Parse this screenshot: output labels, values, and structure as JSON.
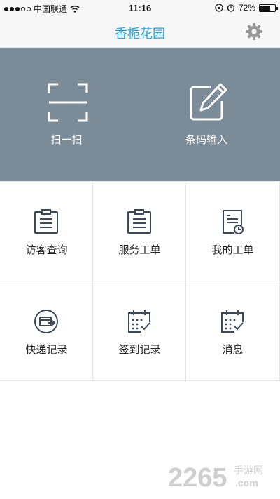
{
  "status_bar": {
    "carrier": "中国联通",
    "time": "11:16",
    "battery": "72%",
    "battery_level": 0.72
  },
  "nav": {
    "title": "香栀花园",
    "settings_icon": "gear-icon"
  },
  "banner": {
    "scan_label": "扫一扫",
    "barcode_label": "条码输入",
    "scan_icon": "scan-frame-icon",
    "barcode_icon": "edit-square-icon",
    "color": "#7b8b97"
  },
  "grid": {
    "items": [
      {
        "label": "访客查询",
        "icon": "clipboard-icon"
      },
      {
        "label": "服务工单",
        "icon": "clipboard-icon"
      },
      {
        "label": "我的工单",
        "icon": "document-clock-icon"
      },
      {
        "label": "快递记录",
        "icon": "package-icon"
      },
      {
        "label": "签到记录",
        "icon": "calendar-check-icon"
      },
      {
        "label": "消息",
        "icon": "calendar-check-icon"
      }
    ]
  },
  "watermark": {
    "brand_number": "2265",
    "brand_suffix": ".com",
    "brand_text": "手游网"
  },
  "colors": {
    "accent": "#2aa3d8",
    "icon_stroke": "#3b4a5a",
    "banner_bg": "#7b8b97"
  }
}
